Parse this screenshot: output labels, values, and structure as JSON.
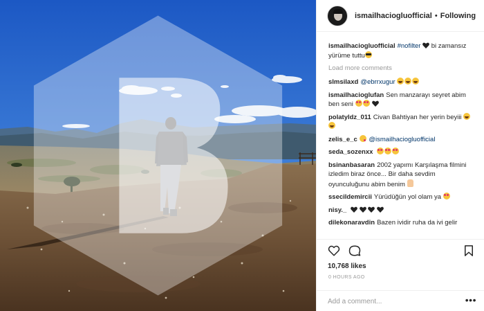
{
  "header": {
    "username": "ismailhacioglu​official",
    "separator": "•",
    "follow_status": "Following"
  },
  "caption": {
    "username": "ismailhacioglu​official",
    "hashtag": "#nofilter",
    "text": "bi zamansız yürüme tuttu"
  },
  "load_more": "Load more comments",
  "comments": [
    {
      "username": "slmsilaxd",
      "text": "@ebrrxugur"
    },
    {
      "username": "ismailhacioglufan",
      "text": "Sen manzarayı seyret abim ben seni"
    },
    {
      "username": "polatyldz_011",
      "text": "Civan Bahtiyan her yerin beyiii"
    },
    {
      "username": "zelis_e_c",
      "text": "@ismailhacioglu​official"
    },
    {
      "username": "seda_sozenxx",
      "text": ""
    },
    {
      "username": "bsinanbasaran",
      "text": "2002 yapımı Karşılaşma filmini izledim biraz önce... Bir daha sevdim oyunculuğunu abim benim"
    },
    {
      "username": "ssecildemircii",
      "text": "Yürüdüğün yol olam ya"
    },
    {
      "username": "nisy._",
      "text": ""
    },
    {
      "username": "dilekonaravdin",
      "text": "Bazen ividir ruha da ivi gelir"
    }
  ],
  "likes": "10,768 likes",
  "timestamp": "0 HOURS AGO",
  "add_comment": {
    "placeholder": "Add a comment..."
  },
  "more_label": "•••",
  "icons": {
    "like": "heart-icon",
    "comment": "comment-icon",
    "save": "bookmark-icon",
    "more": "more-options-icon"
  },
  "colors": {
    "link": "#003569",
    "muted": "#999999",
    "text": "#262626",
    "sky": "#2f6fd0"
  }
}
